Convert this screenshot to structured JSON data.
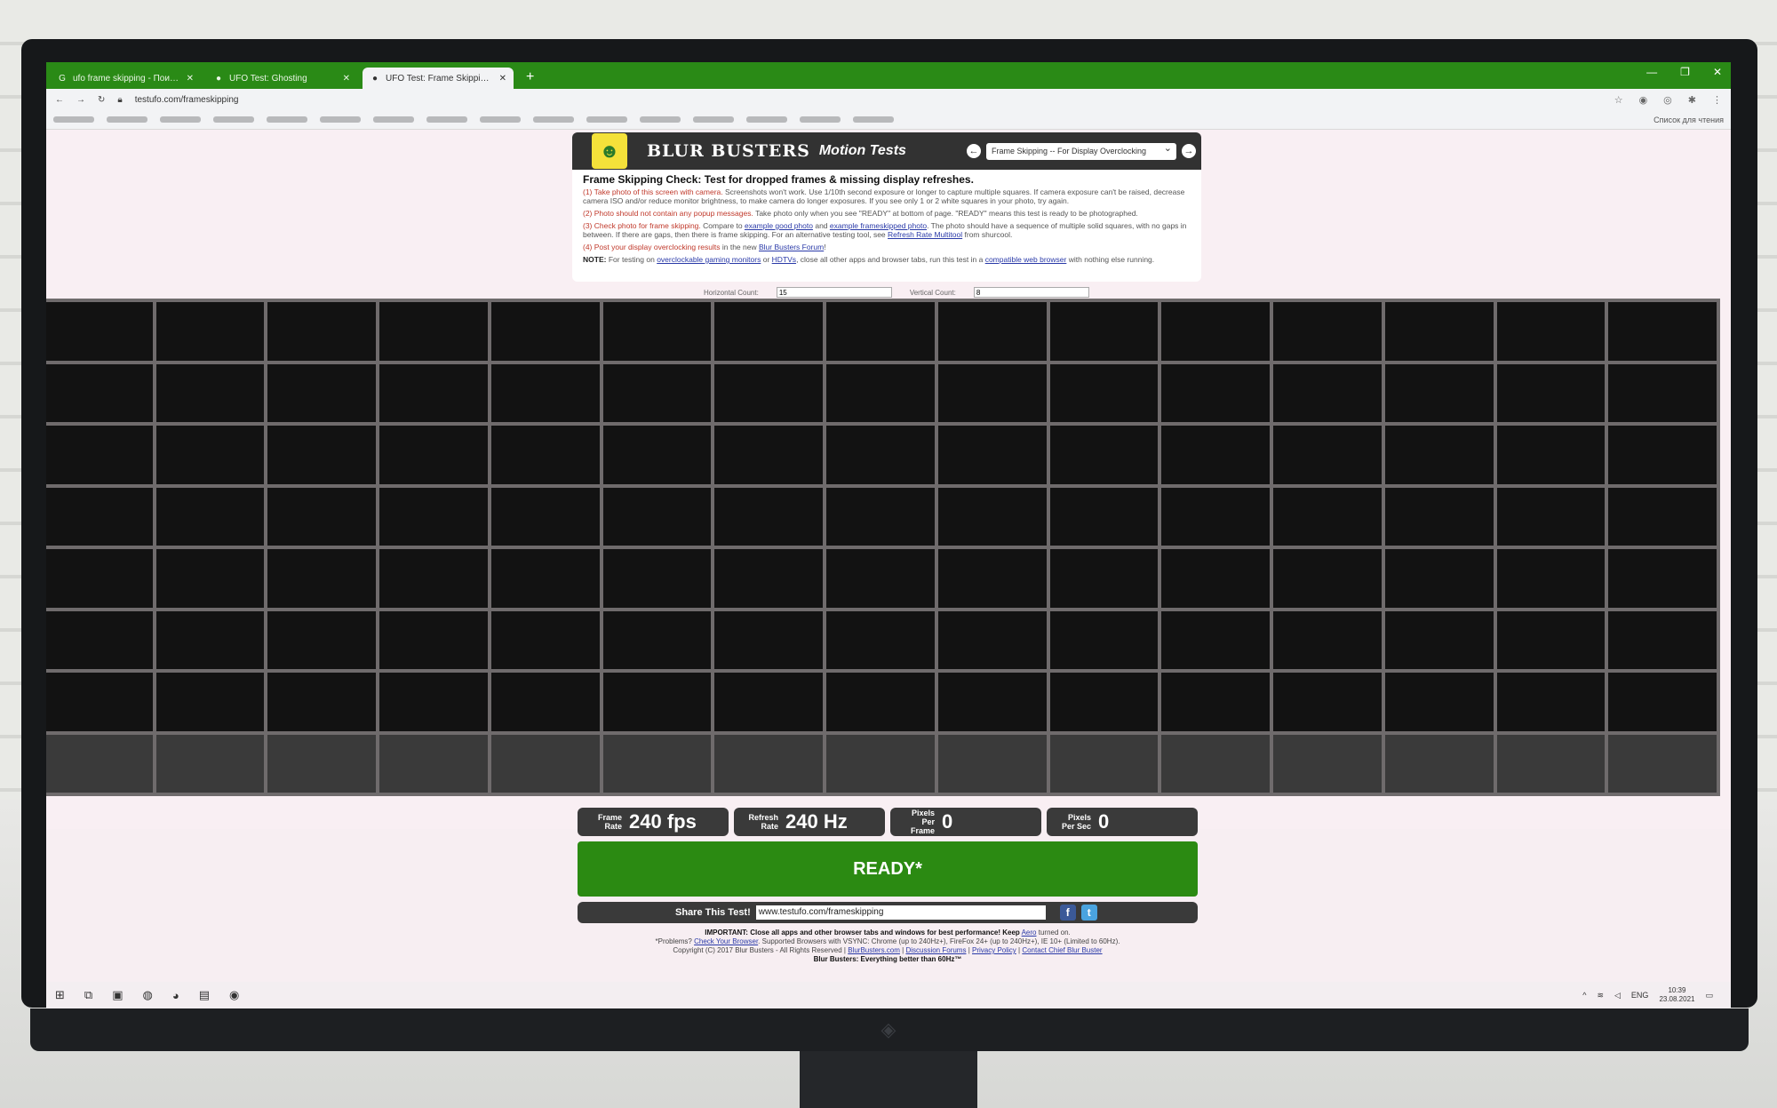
{
  "browser": {
    "tabs": [
      {
        "label": "ufo frame skipping - Поиск в Go",
        "icon": "google-icon"
      },
      {
        "label": "UFO Test: Ghosting",
        "icon": "ufo-icon"
      },
      {
        "label": "UFO Test: Frame Skipping Check",
        "icon": "ufo-icon"
      }
    ],
    "new_tab": "+",
    "url": "testufo.com/frameskipping",
    "reading_list": "Список для чтения"
  },
  "header": {
    "brand": "BLUR BUSTERS",
    "brand_sub": "Motion Tests",
    "test_select": "Frame Skipping -- For Display Overclocking"
  },
  "info": {
    "title": "Frame Skipping Check: Test for dropped frames & missing display refreshes.",
    "step1_lead": "(1) Take photo of this screen with camera.",
    "step1_text": "Screenshots won't work. Use 1/10th second exposure or longer to capture multiple squares. If camera exposure can't be raised, decrease camera ISO and/or reduce monitor brightness, to make camera do longer exposures. If you see only 1 or 2 white squares in your photo, try again.",
    "step2_lead": "(2) Photo should not contain any popup messages.",
    "step2_text": "Take photo only when you see \"READY\" at bottom of page. \"READY\" means this test is ready to be photographed.",
    "step3_lead": "(3) Check photo for frame skipping.",
    "step3_pre": "Compare to",
    "step3_link1": "example good photo",
    "step3_and": "and",
    "step3_link2": "example frameskipped photo",
    "step3_text": ". The photo should have a sequence of multiple solid squares, with no gaps in between. If there are gaps, then there is frame skipping. For an alternative testing tool, see",
    "step3_link3": "Refresh Rate Multitool",
    "step3_post": "from shurcool.",
    "step4_lead": "(4) Post your display overclocking results",
    "step4_text": "in the new",
    "step4_link": "Blur Busters Forum",
    "step4_post": "!",
    "note_label": "NOTE:",
    "note_text1": "For testing on",
    "note_link1": "overclockable gaming monitors",
    "note_or": "or",
    "note_link2": "HDTVs",
    "note_text2": ", close all other apps and browser tabs, run this test in a",
    "note_link3": "compatible web browser",
    "note_text3": "with nothing else running."
  },
  "counts": {
    "horizontal_label": "Horizontal Count:",
    "horizontal_value": "15",
    "vertical_label": "Vertical Count:",
    "vertical_value": "8"
  },
  "grid": {
    "columns": 15,
    "rows": 8,
    "lit_cells": [
      105,
      106,
      107,
      108,
      109,
      110,
      111,
      112,
      113,
      114,
      115,
      116,
      117,
      118,
      119,
      120,
      121,
      122,
      123,
      124,
      125,
      126
    ]
  },
  "stats": [
    {
      "label": "Frame\nRate",
      "value": "240 fps"
    },
    {
      "label": "Refresh\nRate",
      "value": "240 Hz"
    },
    {
      "label": "Pixels\nPer Frame",
      "value": "0"
    },
    {
      "label": "Pixels\nPer Sec",
      "value": "0"
    }
  ],
  "ready_label": "READY*",
  "share": {
    "label": "Share This Test!",
    "url": "www.testufo.com/frameskipping",
    "fb": "f",
    "tw": "t"
  },
  "footer": {
    "important": "IMPORTANT: Close all apps and other browser tabs and windows for best performance! Keep",
    "aero": "Aero",
    "important_post": "turned on.",
    "problems": "*Problems?",
    "check_browser": "Check Your Browser",
    "supported": ". Supported Browsers with VSYNC: Chrome (up to 240Hz+), FireFox 24+ (up to 240Hz+), IE 10+ (Limited to 60Hz).",
    "copyright": "Copyright (C) 2017 Blur Busters - All Rights Reserved |",
    "link_bb": "BlurBusters.com",
    "link_forums": "Discussion Forums",
    "link_privacy": "Privacy Policy",
    "link_contact": "Contact Chief Blur Buster",
    "tagline": "Blur Busters: Everything better than 60Hz™"
  },
  "taskbar": {
    "lang": "ENG",
    "time": "10:39",
    "date": "23.08.2021"
  }
}
